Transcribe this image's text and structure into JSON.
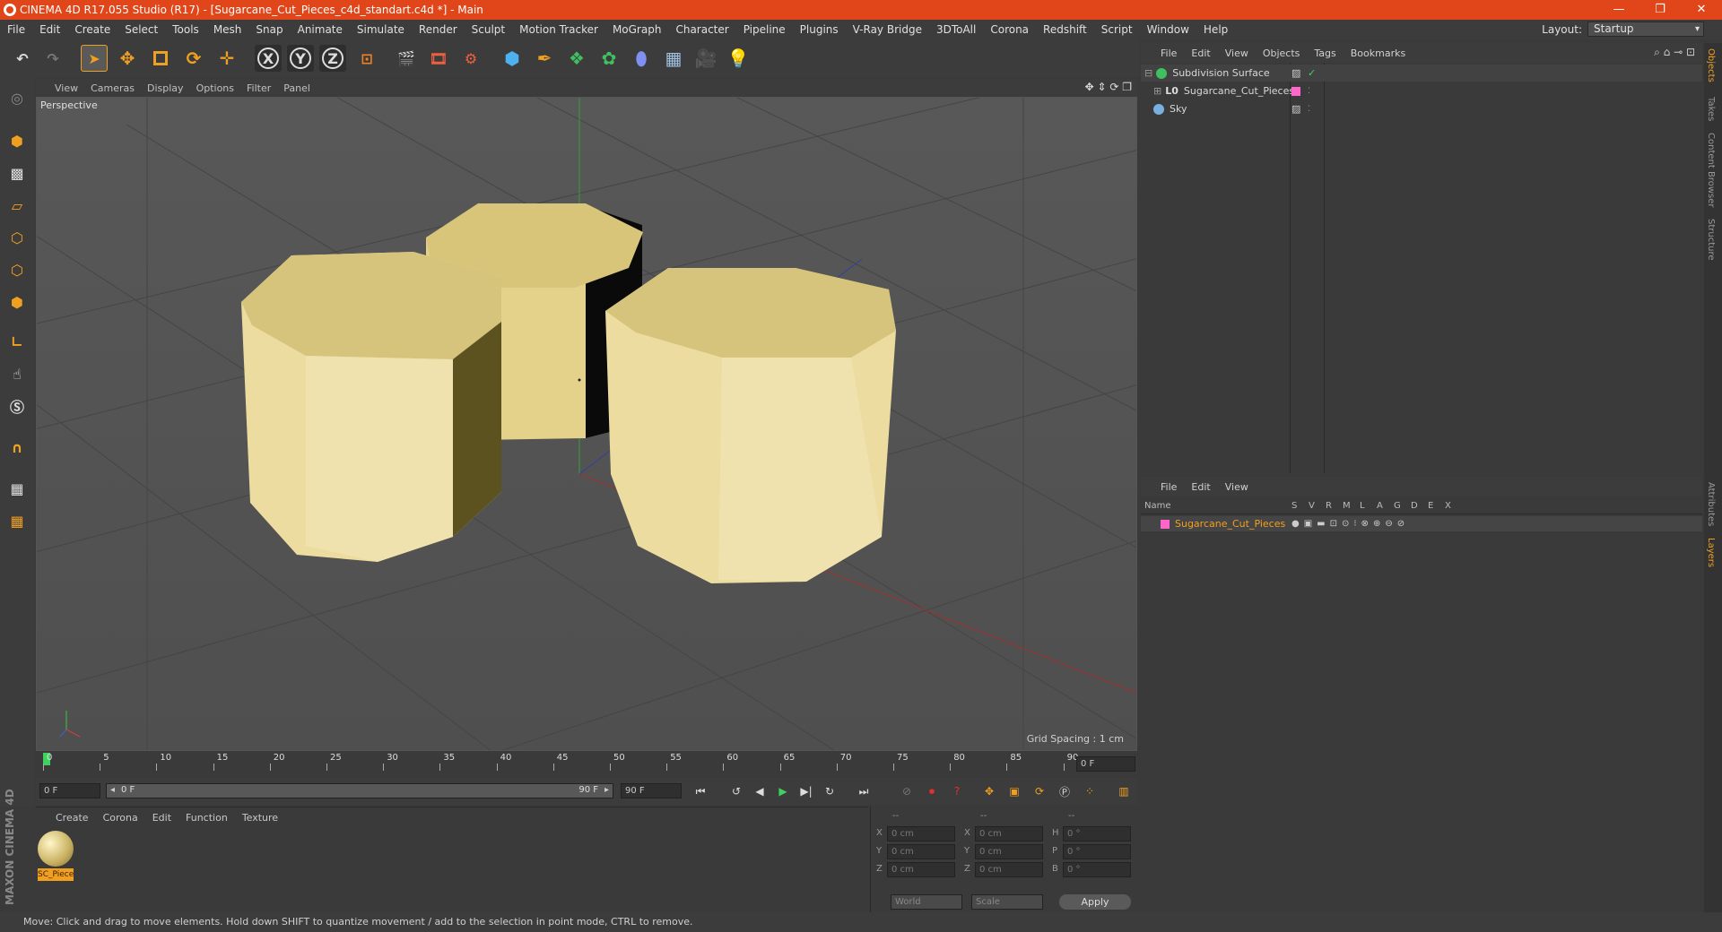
{
  "window": {
    "title": "CINEMA 4D R17.055 Studio (R17) - [Sugarcane_Cut_Pieces_c4d_standart.c4d *] - Main"
  },
  "menu": [
    "File",
    "Edit",
    "Create",
    "Select",
    "Tools",
    "Mesh",
    "Snap",
    "Animate",
    "Simulate",
    "Render",
    "Sculpt",
    "Motion Tracker",
    "MoGraph",
    "Character",
    "Pipeline",
    "Plugins",
    "V-Ray Bridge",
    "3DToAll",
    "Corona",
    "Redshift",
    "Script",
    "Window",
    "Help"
  ],
  "layout": {
    "label": "Layout:",
    "value": "Startup"
  },
  "toolbar": {
    "x_label": "X",
    "y_label": "Y",
    "z_label": "Z"
  },
  "viewport": {
    "menu": [
      "View",
      "Cameras",
      "Display",
      "Options",
      "Filter",
      "Panel"
    ],
    "label": "Perspective",
    "grid_spacing": "Grid Spacing : 1 cm"
  },
  "timeline": {
    "ticks": [
      "0",
      "5",
      "10",
      "15",
      "20",
      "25",
      "30",
      "35",
      "40",
      "45",
      "50",
      "55",
      "60",
      "65",
      "70",
      "75",
      "80",
      "85",
      "90"
    ],
    "current_frame": "0 F",
    "start": "0 F",
    "range_start": "0 F",
    "range_end": "90 F",
    "end": "90 F"
  },
  "material_panel": {
    "menu": [
      "Create",
      "Corona",
      "Edit",
      "Function",
      "Texture"
    ],
    "material_label": "SC_Piece"
  },
  "coords": {
    "headers": [
      "--",
      "--",
      "--"
    ],
    "rows": [
      {
        "a": "X",
        "av": "0 cm",
        "b": "X",
        "bv": "0 cm",
        "c": "H",
        "cv": "0 °"
      },
      {
        "a": "Y",
        "av": "0 cm",
        "b": "Y",
        "bv": "0 cm",
        "c": "P",
        "cv": "0 °"
      },
      {
        "a": "Z",
        "av": "0 cm",
        "b": "Z",
        "bv": "0 cm",
        "c": "B",
        "cv": "0 °"
      }
    ],
    "world": "World",
    "scale": "Scale",
    "apply": "Apply"
  },
  "objects": {
    "menu": [
      "File",
      "Edit",
      "View",
      "Objects",
      "Tags",
      "Bookmarks"
    ],
    "items": [
      {
        "name": "Subdivision Surface"
      },
      {
        "name": "Sugarcane_Cut_Pieces"
      },
      {
        "name": "Sky"
      }
    ]
  },
  "layers": {
    "menu": [
      "File",
      "Edit",
      "View"
    ],
    "header_name": "Name",
    "columns": [
      "S",
      "V",
      "R",
      "M",
      "L",
      "A",
      "G",
      "D",
      "E",
      "X"
    ],
    "row_name": "Sugarcane_Cut_Pieces"
  },
  "right_tabs": [
    "Objects",
    "Takes",
    "Content Browser",
    "Structure",
    "Attributes",
    "Layers"
  ],
  "status": "Move: Click and drag to move elements. Hold down SHIFT to quantize movement / add to the selection in point mode, CTRL to remove.",
  "colors": {
    "title_bar": "#e0461a",
    "accent_orange": "#f0a020",
    "layer_pink": "#ff66cc"
  }
}
